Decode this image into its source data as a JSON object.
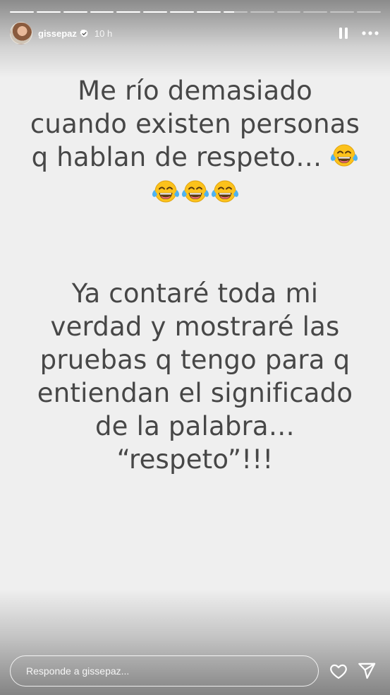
{
  "header": {
    "username": "gissepaz",
    "timestamp": "10 h",
    "avatar_icon": "profile-avatar",
    "verified_icon": "verified-badge-icon",
    "pause_icon": "pause-icon",
    "more_icon": "more-options-icon"
  },
  "progress": {
    "total_segments": 14,
    "completed_segments": 8,
    "current_segment_fraction": 0.45
  },
  "story": {
    "background_color": "#efefef",
    "text_color": "#474747",
    "paragraph1": {
      "lines": [
        "Me río demasiado",
        "cuando existen personas",
        "q hablan de respeto…"
      ],
      "emoji": "face-with-tears-of-joy",
      "emoji_count_inline": 1,
      "emoji_count_row": 3
    },
    "paragraph2": {
      "lines": [
        "Ya contaré toda mi",
        "verdad y mostraré las",
        "pruebas q tengo para q",
        "entiendan el significado",
        "de la palabra…",
        "“respeto”!!!"
      ]
    }
  },
  "reply": {
    "placeholder": "Responde a gissepaz...",
    "heart_icon": "heart-icon",
    "send_icon": "send-icon"
  }
}
